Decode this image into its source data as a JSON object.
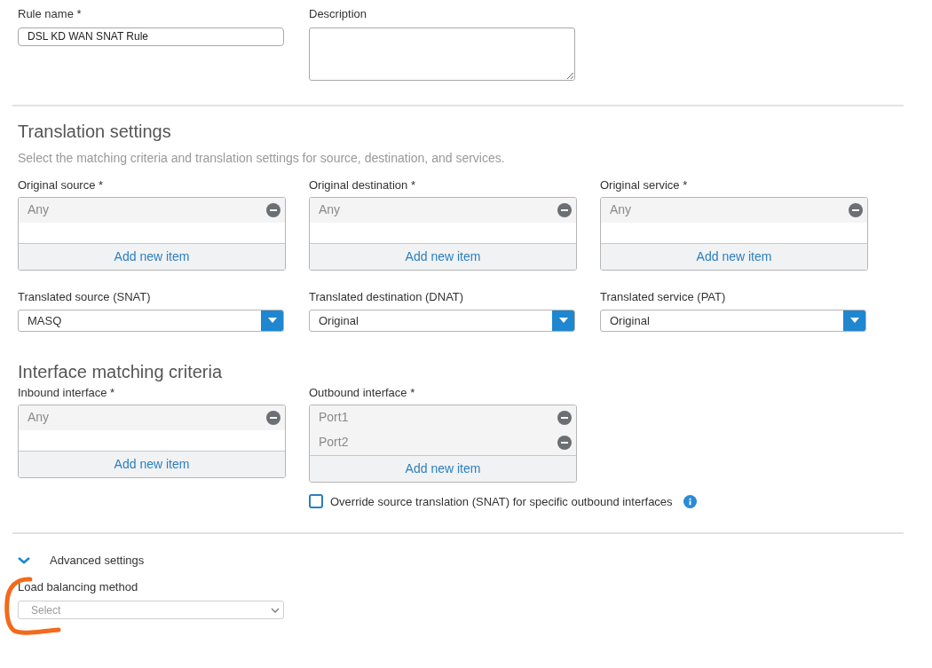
{
  "general": {
    "rule_name": {
      "label": "Rule name *",
      "value": "DSL KD WAN SNAT Rule"
    },
    "description": {
      "label": "Description"
    }
  },
  "translation_settings": {
    "title": "Translation settings",
    "subtitle": "Select the matching criteria and translation settings for source, destination, and services.",
    "originals": [
      {
        "label": "Original source *",
        "items": [
          "Any"
        ],
        "add_label": "Add new item"
      },
      {
        "label": "Original destination *",
        "items": [
          "Any"
        ],
        "add_label": "Add new item"
      },
      {
        "label": "Original service *",
        "items": [
          "Any"
        ],
        "add_label": "Add new item"
      }
    ],
    "translated": [
      {
        "label": "Translated source (SNAT)",
        "value": "MASQ"
      },
      {
        "label": "Translated destination (DNAT)",
        "value": "Original"
      },
      {
        "label": "Translated service (PAT)",
        "value": "Original"
      }
    ]
  },
  "interface_matching": {
    "title": "Interface matching criteria",
    "lists": [
      {
        "label": "Inbound interface *",
        "items": [
          "Any"
        ],
        "add_label": "Add new item"
      },
      {
        "label": "Outbound interface *",
        "items": [
          "Port1",
          "Port2"
        ],
        "add_label": "Add new item"
      }
    ],
    "override": {
      "label": "Override source translation (SNAT) for specific outbound interfaces",
      "checked": false
    }
  },
  "advanced": {
    "label": "Advanced settings",
    "expanded": true,
    "load_balancing": {
      "label": "Load balancing method",
      "placeholder": "Select"
    }
  }
}
